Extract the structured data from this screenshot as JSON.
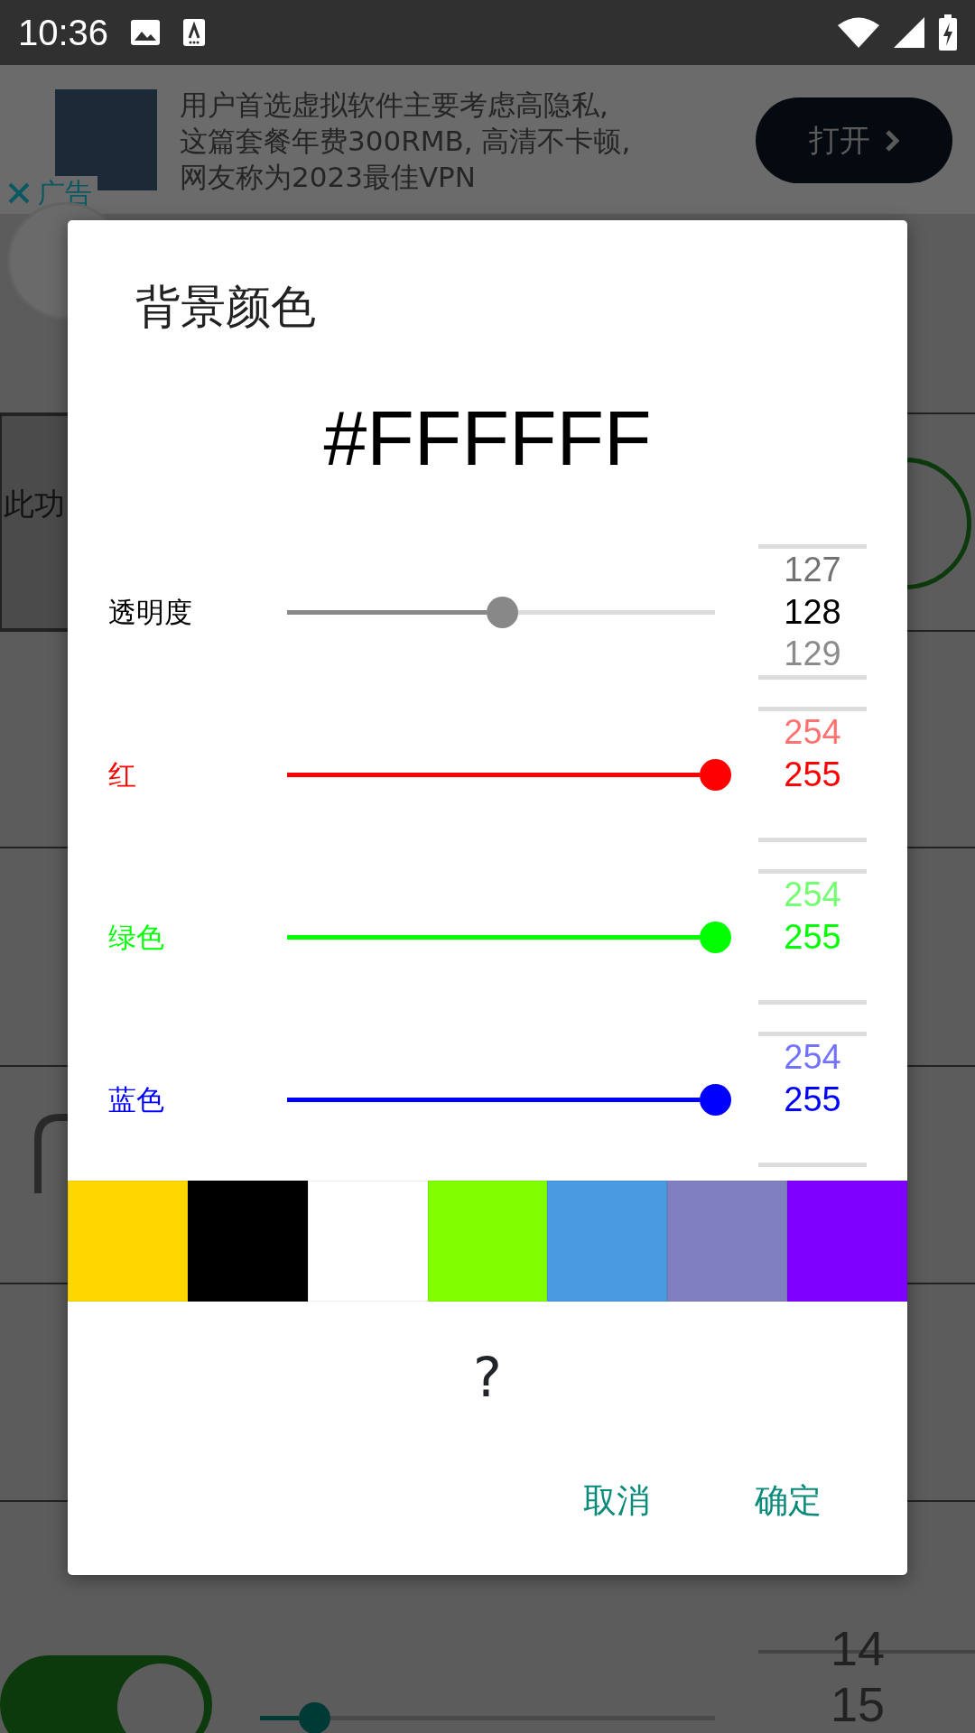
{
  "status_bar": {
    "time": "10:36"
  },
  "ad": {
    "lines": [
      "用户首选虚拟软件主要考虑高隐私,",
      "这篇套餐年费300RMB, 高清不卡顿,",
      "网友称为2023最佳VPN"
    ],
    "button": "打开",
    "close_label": "广告"
  },
  "background": {
    "side_text": "此功",
    "switch_on": true,
    "slider": {
      "level": 0.12
    },
    "picker": [
      "14",
      "15"
    ]
  },
  "dialog": {
    "title": "背景颜色",
    "hex": "#FFFFFF",
    "rows": [
      {
        "kind": "alpha",
        "label": "透明度",
        "color": "#888888",
        "level": 0.502,
        "previous": "127",
        "current": "128",
        "next": "129"
      },
      {
        "kind": "channel",
        "label": "红",
        "color": "#ff0000",
        "level": 1,
        "previous": "254",
        "current": "255"
      },
      {
        "kind": "channel",
        "label": "绿色",
        "color": "#00ff00",
        "level": 1,
        "previous": "254",
        "current": "255"
      },
      {
        "kind": "channel",
        "label": "蓝色",
        "color": "#0000ff",
        "level": 1,
        "previous": "254",
        "current": "255"
      }
    ],
    "swatches": [
      {
        "color": "#ffd700"
      },
      {
        "color": "#000000"
      },
      {
        "color": "#ffffff"
      },
      {
        "color": "#80ff00"
      },
      {
        "color": "#4a9ae1"
      },
      {
        "color": "#8080c0"
      },
      {
        "color": "#8000ff"
      }
    ],
    "preview": "?",
    "buttons": [
      "取消",
      "确定"
    ]
  }
}
